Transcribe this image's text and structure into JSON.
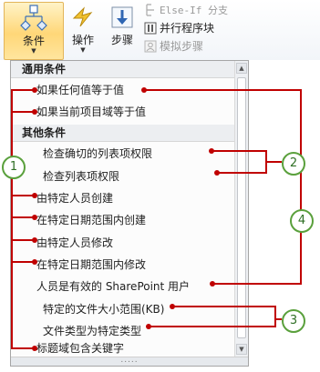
{
  "ribbon": {
    "conditions_label": "条件",
    "actions_label": "操作",
    "steps_label": "步骤",
    "elseif_label": "Else-If 分支",
    "parallel_label": "并行程序块",
    "impersonation_label": "模拟步骤",
    "icons": {
      "conditions": "branch-diagram-icon",
      "actions": "lightning-icon",
      "steps": "down-arrow-step-icon",
      "elseif": "elseif-branch-icon",
      "parallel": "parallel-block-icon",
      "impersonation": "impersonation-icon"
    }
  },
  "menu": {
    "common_header": "通用条件",
    "common_items": [
      "如果任何值等于值",
      "如果当前项目域等于值"
    ],
    "other_header": "其他条件",
    "other_items": [
      "检查确切的列表项权限",
      "检查列表项权限",
      "由特定人员创建",
      "在特定日期范围内创建",
      "由特定人员修改",
      "在特定日期范围内修改",
      "人员是有效的 SharePoint 用户",
      "特定的文件大小范围(KB)",
      "文件类型为特定类型",
      "标题域包含关键字"
    ],
    "grip": "....."
  },
  "callouts": [
    "1",
    "2",
    "3",
    "4"
  ],
  "colors": {
    "callout_line": "#c00000",
    "callout_badge": "#5aa03c",
    "selected_button": "#ffd778"
  }
}
